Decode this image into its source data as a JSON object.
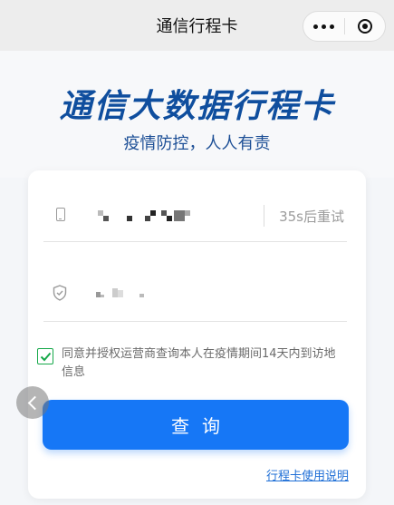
{
  "navbar": {
    "title": "通信行程卡"
  },
  "header": {
    "title": "通信大数据行程卡",
    "subtitle": "疫情防控，人人有责"
  },
  "form": {
    "resend_label": "35s后重试",
    "agreement_text": "同意并授权运营商查询本人在疫情期间14天内到访地信息",
    "agreement_checked": true,
    "query_button": "查询",
    "help_link": "行程卡使用说明"
  },
  "colors": {
    "brand_blue": "#1677f6",
    "title_blue": "#0f4e9e",
    "check_green": "#15a849"
  },
  "icons": [
    "more-dots-icon",
    "close-target-icon",
    "phone-icon",
    "shield-icon",
    "checkmark-icon",
    "chevron-left-icon"
  ]
}
